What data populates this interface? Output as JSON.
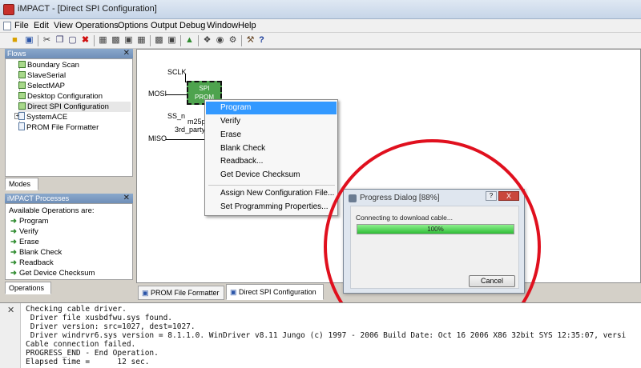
{
  "window": {
    "title": "iMPACT - [Direct SPI Configuration]"
  },
  "menu": [
    "File",
    "Edit",
    "View",
    "Operations",
    "Options",
    "Output",
    "Debug",
    "Window",
    "Help"
  ],
  "toolbar": {
    "icons": [
      "open-folder-icon",
      "save-icon",
      "cut-icon",
      "copy-icon",
      "paste-icon",
      "delete-icon",
      "initialize-chain-icon",
      "assign-file-icon",
      "program-icon",
      "blank-check-icon",
      "verify-icon",
      "erase-icon",
      "identify-icon",
      "cable-setup-icon",
      "cable-reset-icon",
      "tools-icon",
      "help-icon"
    ]
  },
  "flows": {
    "header": "Flows",
    "items": [
      "Boundary Scan",
      "SlaveSerial",
      "SelectMAP",
      "Desktop Configuration",
      "Direct SPI Configuration",
      "SystemACE",
      "PROM File Formatter"
    ],
    "selected_index": 4,
    "tab": "Modes"
  },
  "processes": {
    "header": "iMPACT Processes",
    "intro": "Available Operations are:",
    "items": [
      "Program",
      "Verify",
      "Erase",
      "Blank Check",
      "Readback",
      "Get Device Checksum"
    ],
    "tab": "Operations"
  },
  "canvas": {
    "signals": [
      "SCLK",
      "MOSI",
      "SS_n",
      "MISO"
    ],
    "chip_label": [
      "SPI",
      "PROM"
    ],
    "chip_part": "m25p",
    "chip_vendor": "3rd_party_"
  },
  "context_menu": {
    "items": [
      "Program",
      "Verify",
      "Erase",
      "Blank Check",
      "Readback...",
      "Get Device Checksum"
    ],
    "items2": [
      "Assign New Configuration File...",
      "Set Programming Properties..."
    ],
    "highlighted_index": 0
  },
  "bottom_tabs": [
    "PROM File Formatter",
    "Direct SPI Configuration"
  ],
  "bottom_tab_active": 1,
  "progress_dialog": {
    "title": "Progress Dialog [88%]",
    "message": "Connecting to download cable...",
    "progress_fraction": 1.0,
    "progress_label": "100%",
    "help_label": "?",
    "close_label": "X",
    "cancel_label": "Cancel"
  },
  "console": {
    "lines": [
      "Checking cable driver.",
      " Driver file xusbdfwu.sys found.",
      " Driver version: src=1027, dest=1027.",
      " Driver windrvr6.sys version = 8.1.1.0. WinDriver v8.11 Jungo (c) 1997 - 2006 Build Date: Oct 16 2006 X86 32bit SYS 12:35:07, versi",
      "Cable connection failed.",
      "PROGRESS_END - End Operation.",
      "Elapsed time =      12 sec."
    ]
  },
  "colors": {
    "annotation_circle": "#e0101e",
    "menu_highlight": "#3399ff",
    "progress_green": "#2ebd36",
    "chip_green": "#4ea34e",
    "panel_header": "#7b98c2"
  }
}
